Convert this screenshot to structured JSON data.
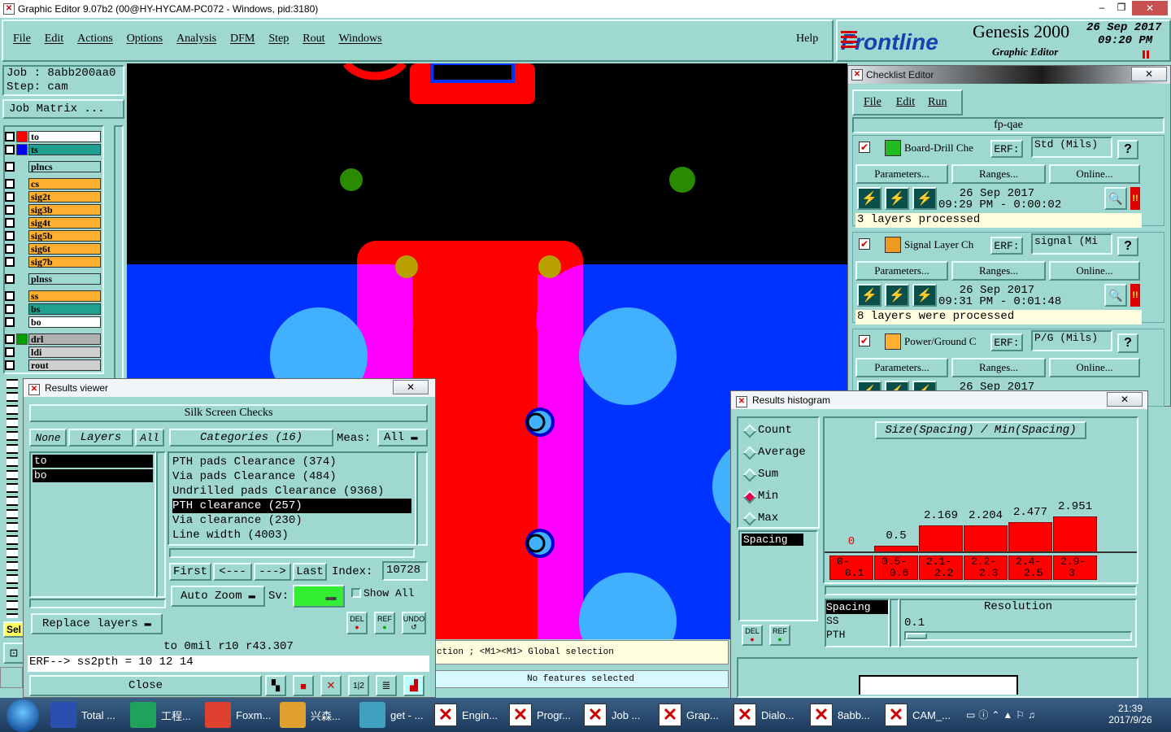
{
  "window": {
    "title": "Graphic Editor 9.07b2 (00@HY-HYCAM-PC072 - Windows, pid:3180)"
  },
  "menu": {
    "items": [
      "File",
      "Edit",
      "Actions",
      "Options",
      "Analysis",
      "DFM",
      "Step",
      "Rout",
      "Windows"
    ],
    "help": "Help"
  },
  "brand": {
    "logo": "Frontline",
    "product": "Genesis 2000",
    "subtitle": "Graphic Editor",
    "date": "26 Sep 2017",
    "time": "09:20 PM"
  },
  "job": {
    "job_label": "Job  : 8abb200aa0",
    "step_label": "Step: cam",
    "matrix_button": "Job Matrix ..."
  },
  "layers": [
    {
      "name": "to",
      "color": "#ff0000",
      "bg": "#ffffff"
    },
    {
      "name": "ts",
      "color": "#0000ff",
      "bg": "#20a090"
    },
    {
      "name": "plncs",
      "color": "",
      "bg": "#9fd8d0"
    },
    {
      "name": "cs",
      "color": "",
      "bg": "#ffb030"
    },
    {
      "name": "sig2t",
      "color": "",
      "bg": "#ffb030"
    },
    {
      "name": "sig3b",
      "color": "",
      "bg": "#ffb030"
    },
    {
      "name": "sig4t",
      "color": "",
      "bg": "#ffb030"
    },
    {
      "name": "sig5b",
      "color": "",
      "bg": "#ffb030"
    },
    {
      "name": "sig6t",
      "color": "",
      "bg": "#ffb030"
    },
    {
      "name": "sig7b",
      "color": "",
      "bg": "#ffb030"
    },
    {
      "name": "plnss",
      "color": "",
      "bg": "#9fd8d0"
    },
    {
      "name": "ss",
      "color": "",
      "bg": "#ffb030"
    },
    {
      "name": "bs",
      "color": "",
      "bg": "#20a090"
    },
    {
      "name": "bo",
      "color": "",
      "bg": "#ffffff"
    },
    {
      "name": "drl",
      "color": "#00a000",
      "bg": "#b0b0b0"
    },
    {
      "name": "ldi",
      "color": "",
      "bg": "#d0d0d0"
    },
    {
      "name": "rout",
      "color": "",
      "bg": "#d0d0d0"
    }
  ],
  "side_label": "Sel",
  "checklist": {
    "title": "Checklist Editor",
    "menu": [
      "File",
      "Edit",
      "Run"
    ],
    "name": "fp-qae",
    "param_btn": "Parameters...",
    "ranges_btn": "Ranges...",
    "online_btn": "Online...",
    "erf_label": "ERF:",
    "help_q": "?",
    "checks": [
      {
        "name": "Board-Drill Che",
        "erf": "Std (Mils)",
        "date": "26 Sep 2017",
        "time": "09:29 PM - 0:00:02",
        "status": "3 layers processed"
      },
      {
        "name": "Signal Layer Ch",
        "erf": "signal (Mi",
        "date": "26 Sep 2017",
        "time": "09:31 PM - 0:01:48",
        "status": "8 layers were processed"
      },
      {
        "name": "Power/Ground C",
        "erf": "P/G (Mils)",
        "date": "26 Sep 2017",
        "time": "",
        "status": ""
      }
    ]
  },
  "results_viewer": {
    "title": "Results viewer",
    "header": "Silk Screen Checks",
    "none_btn": "None",
    "layers_btn": "Layers",
    "all_btn": "All",
    "categories_btn": "Categories (16)",
    "meas_label": "Meas:",
    "meas_value": "All",
    "layers": [
      "to",
      "bo"
    ],
    "categories": [
      "PTH pads Clearance (374)",
      "Via pads Clearance (484)",
      "Undrilled pads Clearance (9368)",
      "PTH clearance (257)",
      "Via clearance (230)",
      "Line width (4003)"
    ],
    "selected_category": "PTH clearance (257)",
    "first_btn": "First",
    "prev_btn": "<---",
    "next_btn": "--->",
    "last_btn": "Last",
    "index_label": "Index:",
    "index_value": "10728",
    "auto_zoom": "Auto Zoom",
    "sv_label": "Sv:",
    "show_all": "Show All",
    "replace_layers": "Replace layers",
    "del": "DEL",
    "ref": "REF",
    "undo": "UNDO",
    "info_line": "to 0mil  r10  r43.307",
    "erf_line": "ERF--> ss2pth = 10 12 14",
    "close_btn": "Close"
  },
  "status": {
    "prompt": "ction ; <M1><M1> Global selection",
    "features": "No features selected"
  },
  "histogram": {
    "title": "Results histogram",
    "modes": [
      "Count",
      "Average",
      "Sum",
      "Min",
      "Max"
    ],
    "selected_mode": "Min",
    "chart_title": "Size(Spacing) / Min(Spacing)",
    "list_top": [
      "Spacing"
    ],
    "list_bottom": [
      "Spacing",
      "SS",
      "PTH"
    ],
    "resolution_label": "Resolution",
    "resolution_value": "0.1",
    "del": "DEL",
    "ref": "REF"
  },
  "chart_data": {
    "type": "bar",
    "categories": [
      "0-0.1",
      "0.5-0.6",
      "2.1-2.2",
      "2.2-2.3",
      "2.4-2.5",
      "2.9-3"
    ],
    "values": [
      0,
      0.5,
      2.169,
      2.204,
      2.477,
      2.951
    ],
    "value_labels": [
      "0",
      "0.5",
      "2.169",
      "2.204",
      "2.477",
      "2.951"
    ],
    "bin_labels_top": [
      "0-",
      "0.5-",
      "2.1-",
      "2.2-",
      "2.4-",
      "2.9-"
    ],
    "bin_labels_bottom": [
      "0.1",
      "0.6",
      "2.2",
      "2.3",
      "2.5",
      "3"
    ],
    "title": "Size(Spacing) / Min(Spacing)",
    "ylim": [
      0,
      3
    ]
  },
  "taskbar": {
    "items": [
      "Total ...",
      "工程...",
      "Foxm...",
      "兴森...",
      "get - ...",
      "Engin...",
      "Progr...",
      "Job ...",
      "Grap...",
      "Dialo...",
      "8abb...",
      "CAM_..."
    ],
    "time": "21:39",
    "date": "2017/9/26"
  }
}
